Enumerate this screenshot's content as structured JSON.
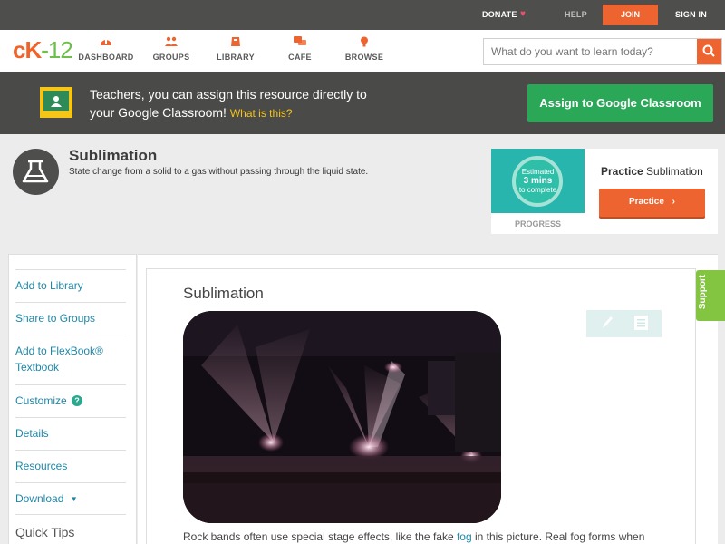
{
  "topbar": {
    "donate": "DONATE",
    "help": "HELP",
    "join": "JOIN",
    "signin": "SIGN IN"
  },
  "nav": {
    "logo_ck": "cK",
    "logo_dash": "-",
    "logo_num": "12",
    "items": [
      {
        "label": "DASHBOARD",
        "icon": "dashboard-icon"
      },
      {
        "label": "GROUPS",
        "icon": "groups-icon"
      },
      {
        "label": "LIBRARY",
        "icon": "library-icon"
      },
      {
        "label": "CAFE",
        "icon": "cafe-icon"
      },
      {
        "label": "BROWSE",
        "icon": "browse-icon"
      }
    ],
    "search_placeholder": "What do you want to learn today?"
  },
  "banner": {
    "line1": "Teachers, you can assign this resource directly to",
    "line2": "your Google Classroom!",
    "what": "What is this?",
    "assign_button": "Assign to Google Classroom"
  },
  "concept": {
    "title": "Sublimation",
    "description": "State change from a solid to a gas without passing through the liquid state."
  },
  "progress": {
    "est1": "Estimated",
    "est2": "3 mins",
    "est3": "to complete",
    "label": "PROGRESS",
    "practice_bold": "Practice",
    "practice_topic": "Sublimation",
    "practice_button": "Practice"
  },
  "sidebar": {
    "add_library": "Add to Library",
    "share_groups": "Share to Groups",
    "add_flexbook_1": "Add to FlexBook®",
    "add_flexbook_2": "Textbook",
    "customize": "Customize",
    "customize_help": "?",
    "details": "Details",
    "resources": "Resources",
    "download": "Download",
    "download_caret": "▼",
    "quick_tips": "Quick Tips"
  },
  "article": {
    "title": "Sublimation",
    "body_pre": "Rock bands often use special stage effects, like the fake ",
    "body_link": "fog",
    "body_post": " in this picture. Real fog forms when"
  },
  "support": "Support",
  "colors": {
    "accent_orange": "#ee6430",
    "green": "#2aa757",
    "link_blue": "#1e88a8",
    "dark_bar": "#4e4e4c"
  }
}
